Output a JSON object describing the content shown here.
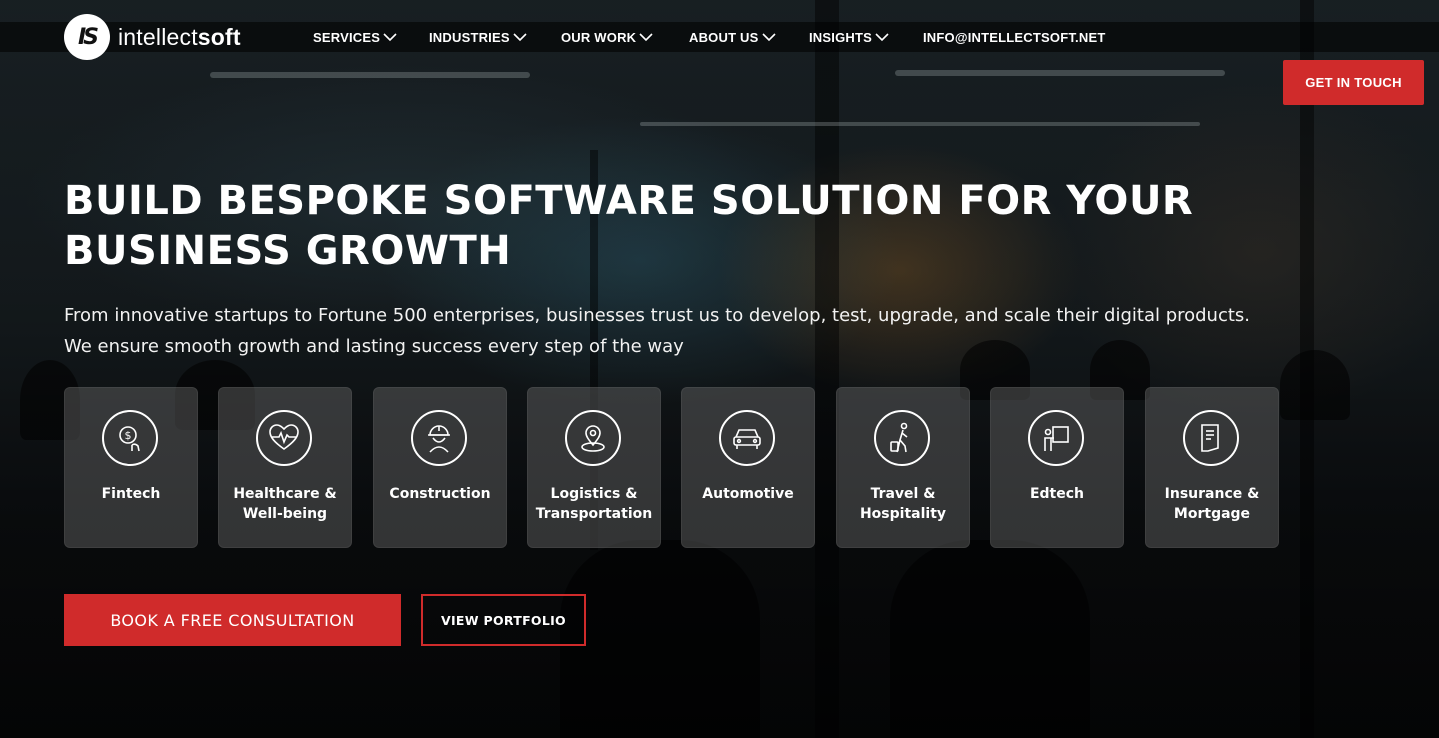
{
  "brand": {
    "mark": "IS",
    "name_light": "intellect",
    "name_bold": "soft"
  },
  "nav": {
    "items": [
      {
        "label": "SERVICES",
        "dropdown": true
      },
      {
        "label": "INDUSTRIES",
        "dropdown": true
      },
      {
        "label": "OUR WORK",
        "dropdown": true
      },
      {
        "label": "ABOUT US",
        "dropdown": true
      },
      {
        "label": "INSIGHTS",
        "dropdown": true
      },
      {
        "label": "INFO@INTELLECTSOFT.NET",
        "dropdown": false
      }
    ],
    "cta": "GET IN TOUCH"
  },
  "hero": {
    "headline_line1": "BUILD BESPOKE SOFTWARE SOLUTION FOR YOUR",
    "headline_line2": "BUSINESS GROWTH",
    "subtext_line1": "From innovative startups to Fortune 500 enterprises, businesses trust us to develop, test, upgrade, and scale their digital products.",
    "subtext_line2": "We ensure smooth growth and lasting success every step of the way"
  },
  "industries": [
    {
      "icon": "fintech-icon",
      "line1": "Fintech",
      "line2": ""
    },
    {
      "icon": "healthcare-icon",
      "line1": "Healthcare &",
      "line2": "Well-being"
    },
    {
      "icon": "construction-icon",
      "line1": "Construction",
      "line2": ""
    },
    {
      "icon": "logistics-icon",
      "line1": "Logistics &",
      "line2": "Transportation"
    },
    {
      "icon": "automotive-icon",
      "line1": "Automotive",
      "line2": ""
    },
    {
      "icon": "travel-icon",
      "line1": "Travel &",
      "line2": "Hospitality"
    },
    {
      "icon": "edtech-icon",
      "line1": "Edtech",
      "line2": ""
    },
    {
      "icon": "insurance-icon",
      "line1": "Insurance &",
      "line2": "Mortgage"
    }
  ],
  "actions": {
    "primary": "BOOK A FREE CONSULTATION",
    "secondary": "VIEW PORTFOLIO"
  },
  "colors": {
    "accent": "#d02b2b",
    "text": "#ffffff",
    "card_bg": "rgba(105,105,105,0.45)"
  }
}
